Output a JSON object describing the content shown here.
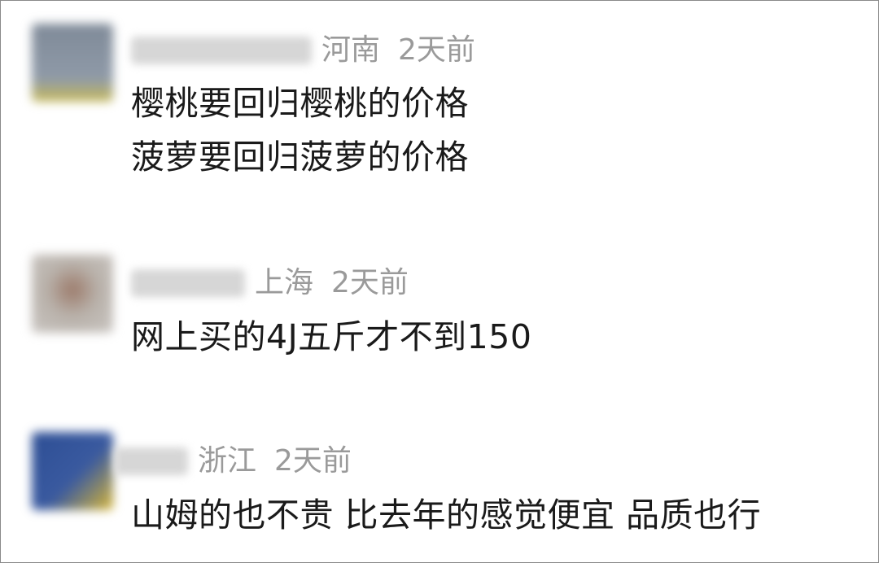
{
  "comments": [
    {
      "location": "河南",
      "time": "2天前",
      "lines": [
        "樱桃要回归樱桃的价格",
        "菠萝要回归菠萝的价格"
      ],
      "avatar_colors": [
        "#8f9aa8",
        "#c7ba5a"
      ]
    },
    {
      "location": "上海",
      "time": "2天前",
      "lines": [
        "网上买的4J五斤才不到150"
      ],
      "avatar_colors": [
        "#b9b2ab",
        "#9c7b6b"
      ]
    },
    {
      "location": "浙江",
      "time": "2天前",
      "lines": [
        "山姆的也不贵 比去年的感觉便宜 品质也行"
      ],
      "avatar_colors": [
        "#2d4e94",
        "#d9b735"
      ]
    }
  ]
}
